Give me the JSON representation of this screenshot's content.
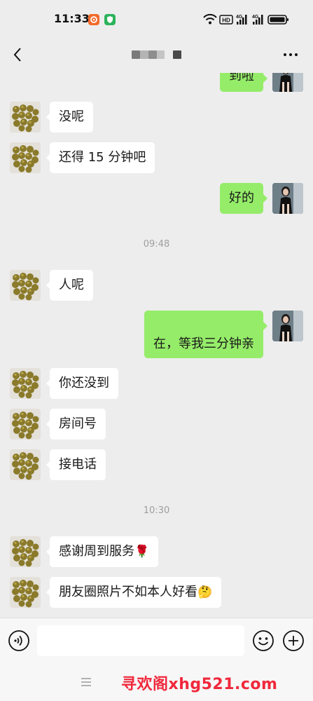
{
  "status_bar": {
    "time": "11:33",
    "app_icons": [
      "orange-app-icon",
      "green-shield-icon"
    ],
    "right_icons": [
      "wifi-icon",
      "hd-icon",
      "signal-4g-icon",
      "signal-4g-icon",
      "battery-icon"
    ],
    "hd_label": "HD",
    "network_label_1": "4G",
    "network_label_2": "4G"
  },
  "nav": {
    "back_icon": "back-arrow-icon",
    "more_icon": "more-dots-icon"
  },
  "messages": [
    {
      "side": "right",
      "text": "到啦"
    },
    {
      "side": "left",
      "text": "没呢"
    },
    {
      "side": "left",
      "text": "还得 15 分钟吧"
    },
    {
      "side": "right",
      "text": "好的"
    },
    {
      "type": "time",
      "text": "09:48"
    },
    {
      "side": "left",
      "text": "人呢"
    },
    {
      "side": "right",
      "text": "在，等我三分钟亲"
    },
    {
      "side": "left",
      "text": "你还没到"
    },
    {
      "side": "left",
      "text": "房间号"
    },
    {
      "side": "left",
      "text": "接电话"
    },
    {
      "type": "time",
      "text": "10:30"
    },
    {
      "side": "left",
      "text": "感谢周到服务",
      "emoji": "🌹"
    },
    {
      "side": "left",
      "text": "朋友圈照片不如本人好看",
      "emoji": "🤔"
    }
  ],
  "input_bar": {
    "voice_icon": "voice-icon",
    "emoji_icon": "emoji-smile-icon",
    "plus_icon": "plus-circle-icon",
    "text_value": ""
  },
  "bottom": {
    "menu_icon": "hamburger-menu-icon",
    "watermark": "寻欢阁xhg521.com"
  },
  "colors": {
    "background": "#ededed",
    "sent_bubble": "#95ec69",
    "received_bubble": "#ffffff",
    "timestamp": "#9e9e9e",
    "watermark": "#f0283c"
  }
}
